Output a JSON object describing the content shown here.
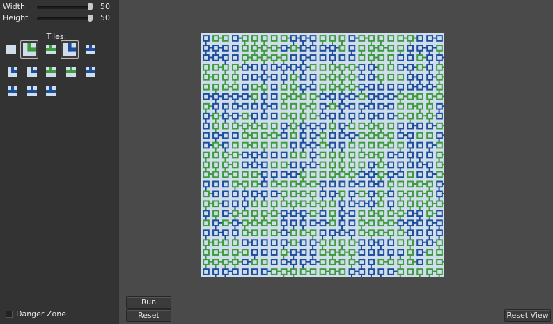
{
  "sidebar": {
    "sliders": [
      {
        "label": "Width",
        "value": "50",
        "level": 0.97
      },
      {
        "label": "Height",
        "value": "50",
        "level": 0.97
      }
    ],
    "tiles_label": "Tiles:",
    "tiles": [
      {
        "icon": "blank-tile-icon",
        "kind": "blank",
        "selected": false
      },
      {
        "icon": "corner-tile-icon",
        "kind": "corner-green",
        "selected": true
      },
      {
        "icon": "tee-tile-icon",
        "kind": "tee-green",
        "selected": false
      },
      {
        "icon": "corner-tile-icon",
        "kind": "corner-blue",
        "selected": true
      },
      {
        "icon": "tee-tile-icon",
        "kind": "tee-blue",
        "selected": false
      },
      {
        "icon": "corner-tile-icon",
        "kind": "corner-blue",
        "selected": false
      },
      {
        "icon": "corner-tile-icon",
        "kind": "corner-blue",
        "selected": false
      },
      {
        "icon": "tee-tile-icon",
        "kind": "tee-green",
        "selected": false
      },
      {
        "icon": "tee-tile-icon",
        "kind": "tee-green",
        "selected": false
      },
      {
        "icon": "tee-tile-icon",
        "kind": "tee-blue",
        "selected": false
      },
      {
        "icon": "tee-tile-icon",
        "kind": "tee-blue",
        "selected": false
      },
      {
        "icon": "tee-tile-icon",
        "kind": "tee-blue",
        "selected": false
      },
      {
        "icon": "tee-tile-icon",
        "kind": "tee-blue",
        "selected": false
      }
    ],
    "danger_zone_label": "Danger Zone"
  },
  "buttons": {
    "run": "Run",
    "reset": "Reset",
    "reset_view": "Reset View"
  },
  "colors": {
    "blue": "#1e4d9c",
    "green": "#3f9a3d",
    "tile_bg": "#cfdeea"
  }
}
